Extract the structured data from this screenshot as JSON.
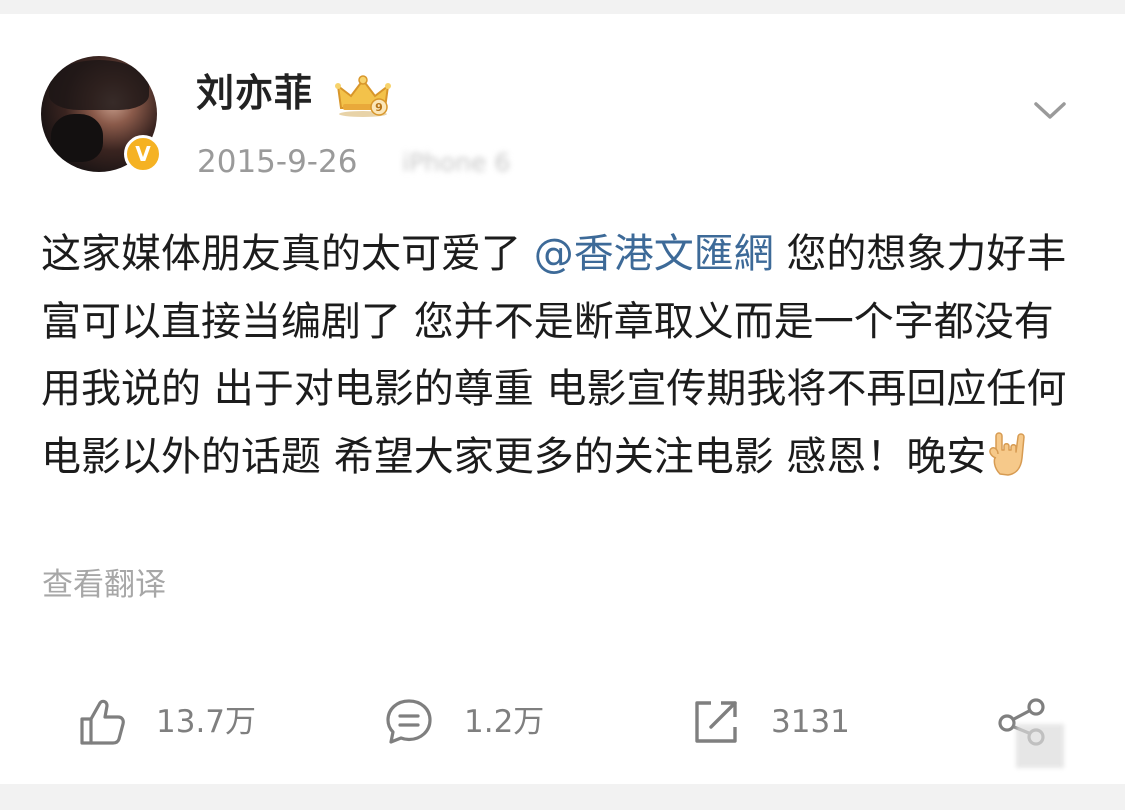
{
  "post": {
    "author": {
      "name": "刘亦菲",
      "verified_badge": "V"
    },
    "meta": {
      "date": "2015-9-26",
      "device": "iPhone 6"
    },
    "content": {
      "text_before": "这家媒体朋友真的太可爱了 ",
      "mention": "@香港文匯網",
      "text_after": " 您的想象力好丰富可以直接当编剧了 您并不是断章取义而是一个字都没有用我说的 出于对电影的尊重 电影宣传期我将不再回应任何电影以外的话题 希望大家更多的关注电影 感恩！晚安",
      "emoji": "rock-hand-emoji"
    },
    "translate_label": "查看翻译",
    "actions": {
      "like_count": "13.7万",
      "comment_count": "1.2万",
      "repost_count": "3131"
    }
  },
  "colors": {
    "mention": "#3d6a98",
    "badge": "#f5b223",
    "text": "#1c1c1c",
    "muted": "#9a9a9a"
  }
}
